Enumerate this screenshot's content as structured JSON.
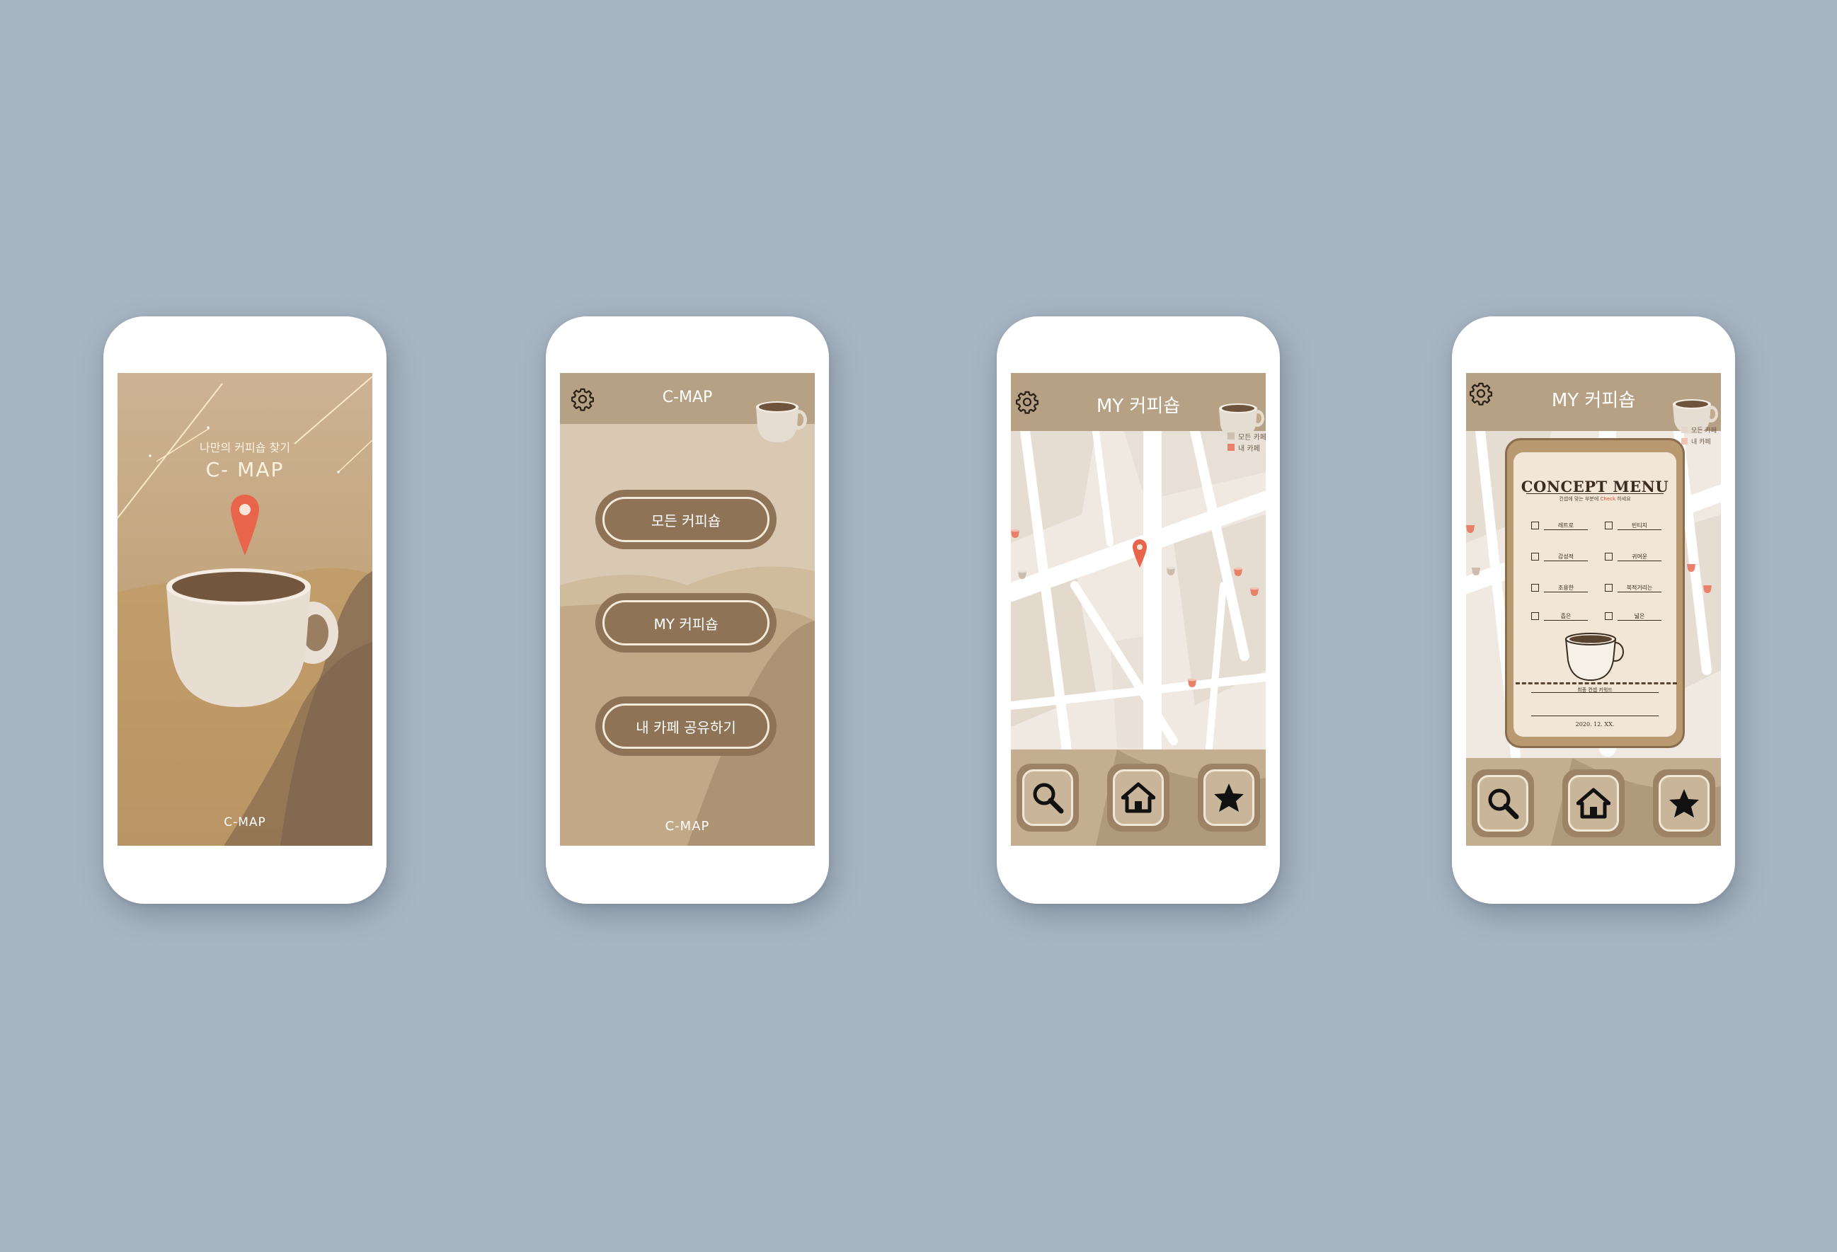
{
  "colors": {
    "background": "#a8b5c2",
    "brown_dark": "#8e7357",
    "header": "#b6a184",
    "accent_pin": "#e8644a"
  },
  "splash": {
    "tagline": "나만의 커피숍 찾기",
    "title": "C- MAP",
    "footer": "C-MAP"
  },
  "home": {
    "app_name": "C-MAP",
    "buttons": [
      "모든 커피숍",
      "MY 커피숍",
      "내 카페 공유하기"
    ],
    "footer": "C-MAP"
  },
  "map_screen": {
    "title": "MY 커피숍",
    "legend": [
      "모든 카페",
      "내 카페"
    ],
    "nav": [
      "search-icon",
      "home-icon",
      "star-icon"
    ]
  },
  "concept_screen": {
    "title": "MY 커피숍",
    "legend": [
      "모든 카페",
      "내 카페"
    ],
    "card_title": "CONCEPT MENU",
    "card_sub_before": "컨셉에 맞는 부분에",
    "card_sub_highlight": "Check",
    "card_sub_after": "하세요",
    "options": [
      "레트로",
      "빈티지",
      "감성적",
      "귀여운",
      "조용한",
      "북적거리는",
      "좁은",
      "넓은"
    ],
    "caption": "최종 컨셉 키워드",
    "date": "2020. 12. XX.",
    "nav": [
      "search-icon",
      "home-icon",
      "star-icon"
    ]
  }
}
